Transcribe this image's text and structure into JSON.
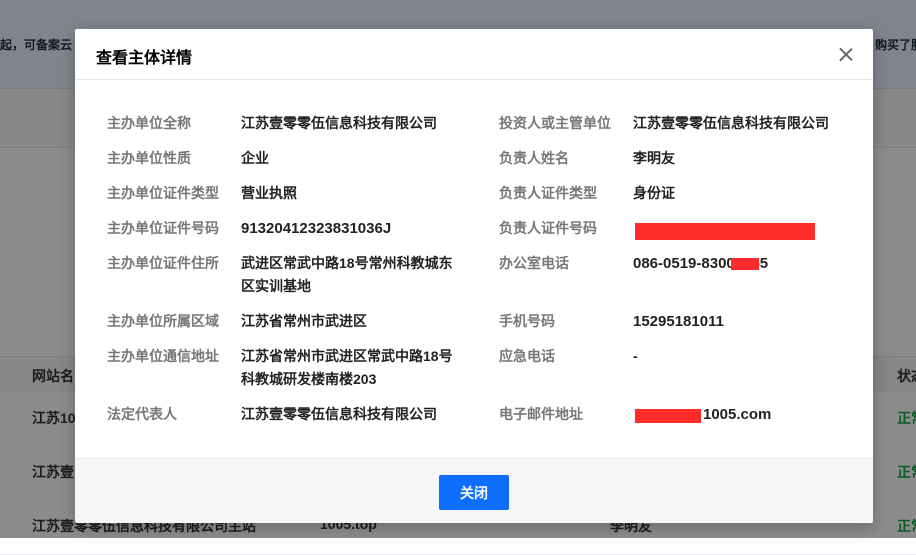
{
  "background": {
    "banner_left": "起，可备案云",
    "banner_right": "购买了服",
    "table_headers": {
      "site_name": "网站名",
      "status": "状态"
    },
    "rows": [
      {
        "site_name": "江苏10",
        "col2": "",
        "col3": "",
        "status": "正常"
      },
      {
        "site_name": "江苏壹",
        "col2": "",
        "col3": "",
        "status": "正常"
      },
      {
        "site_name": "江苏壹零零伍信息科技有限公司主站",
        "col2": "1005.top",
        "col3": "李明友",
        "status": "正常"
      }
    ]
  },
  "modal": {
    "title": "查看主体详情",
    "left_fields": [
      {
        "label": "主办单位全称",
        "value": "江苏壹零零伍信息科技有限公司"
      },
      {
        "label": "主办单位性质",
        "value": "企业"
      },
      {
        "label": "主办单位证件类型",
        "value": "营业执照"
      },
      {
        "label": "主办单位证件号码",
        "value": "91320412323831036J"
      },
      {
        "label": "主办单位证件住所",
        "value": "武进区常武中路18号常州科教城东区实训基地"
      },
      {
        "label": "主办单位所属区域",
        "value": "江苏省常州市武进区"
      },
      {
        "label": "主办单位通信地址",
        "value": "江苏省常州市武进区常武中路18号科教城研发楼南楼203"
      },
      {
        "label": "法定代表人",
        "value": "江苏壹零零伍信息科技有限公司"
      }
    ],
    "right_fields": [
      {
        "label": "投资人或主管单位",
        "value": "江苏壹零零伍信息科技有限公司"
      },
      {
        "label": "负责人姓名",
        "value": "李明友"
      },
      {
        "label": "负责人证件类型",
        "value": "身份证"
      },
      {
        "label": "负责人证件号码",
        "value": ""
      },
      {
        "label": "办公室电话",
        "value": "086-0519-83005055"
      },
      {
        "label": "手机号码",
        "value": "15295181011"
      },
      {
        "label": "应急电话",
        "value": "-"
      },
      {
        "label": "电子邮件地址",
        "value": "1005.com"
      }
    ],
    "close_button": "关闭"
  }
}
